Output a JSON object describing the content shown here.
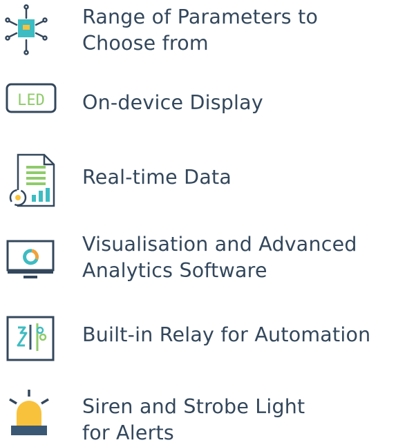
{
  "features": [
    {
      "icon": "circuit-chip-icon",
      "lines": [
        "Range of Parameters to",
        "Choose from"
      ]
    },
    {
      "icon": "led-display-icon",
      "lines": [
        "On-device Display"
      ]
    },
    {
      "icon": "data-document-icon",
      "lines": [
        "Real-time Data"
      ]
    },
    {
      "icon": "monitor-chart-icon",
      "lines": [
        "Visualisation and Advanced",
        "Analytics Software"
      ]
    },
    {
      "icon": "relay-switch-icon",
      "lines": [
        "Built-in Relay for Automation"
      ]
    },
    {
      "icon": "siren-light-icon",
      "lines": [
        "Siren and Strobe Light",
        "for Alerts"
      ]
    }
  ],
  "icon_glyph_text": "LED",
  "colors": {
    "text": "#33475c",
    "dark": "#33475c",
    "teal": "#3dbcc2",
    "green": "#8fcb6a",
    "orange": "#f0a23a",
    "amber": "#f9c23c",
    "blue_dark": "#3a5873"
  }
}
